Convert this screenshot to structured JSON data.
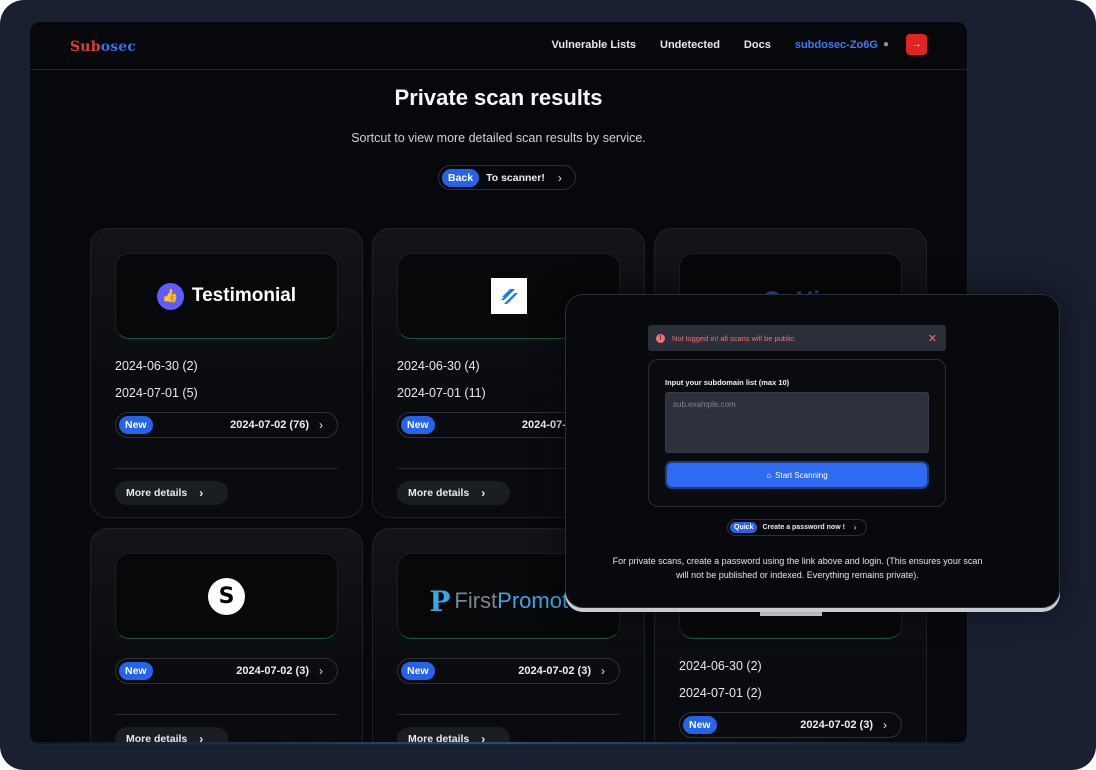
{
  "nav": {
    "logo_part1": "Sub",
    "logo_part2": "osec",
    "links": [
      "Vulnerable Lists",
      "Undetected",
      "Docs"
    ],
    "user": "subdosec-Zo6G",
    "logout_icon": "arrow-right-icon"
  },
  "header": {
    "title": "Private scan results",
    "subtitle": "Sortcut to view more detailed scan results by service.",
    "back_tag": "Back",
    "back_text": "To scanner!"
  },
  "cards": [
    {
      "brand": "Testimonial",
      "dates": [
        "2024-06-30 (2)",
        "2024-07-01 (5)"
      ],
      "new_tag": "New",
      "new_date": "2024-07-02 (76)",
      "more": "More details"
    },
    {
      "brand": "",
      "dates": [
        "2024-06-30 (4)",
        "2024-07-01 (11)"
      ],
      "new_tag": "New",
      "new_date": "2024-07-02 (4",
      "more": "More details"
    },
    {
      "brand": "GoHire",
      "dates": [],
      "new_tag": "",
      "new_date": "",
      "more": ""
    },
    {
      "brand": "",
      "dates": [],
      "new_tag": "New",
      "new_date": "2024-07-02 (3)",
      "more": "More details"
    },
    {
      "brand": "FirstPromoter",
      "brand_first": "First",
      "brand_second": "Promoter",
      "dates": [],
      "new_tag": "New",
      "new_date": "2024-07-02 (3)",
      "more": "More details"
    },
    {
      "brand": "",
      "dates": [
        "2024-06-30 (2)",
        "2024-07-01 (2)"
      ],
      "new_tag": "New",
      "new_date": "2024-07-02 (3)",
      "more": ""
    }
  ],
  "overlay": {
    "alert": "Not logged in! all scans will be public.",
    "input_label": "Input your subdomain list (max 10)",
    "input_placeholder": "sub.example.com",
    "scan_button": "Start Scanning",
    "quick_tag": "Quick",
    "quick_text": "Create a password now !",
    "note": "For private scans, create a password using the link above and login. (This ensures your scan will not be published or indexed. Everything remains private)."
  },
  "colors": {
    "accent": "#2563eb",
    "danger": "#e02424",
    "background": "#07080b"
  }
}
